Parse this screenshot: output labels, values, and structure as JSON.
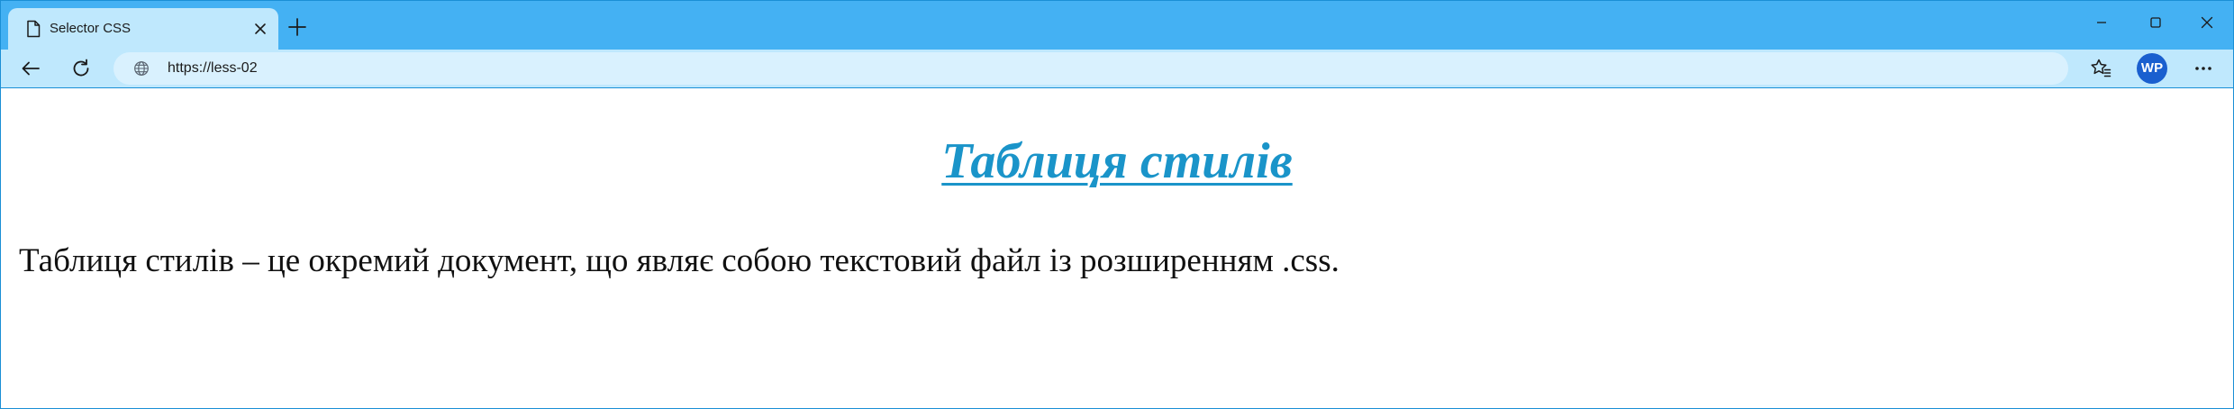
{
  "browser": {
    "tab": {
      "title": "Selector CSS"
    },
    "address_bar": {
      "url": "https://less-02"
    },
    "profile": {
      "initials": "WP",
      "color": "#1a5fcf"
    },
    "colors": {
      "tabstrip": "#44b1f3",
      "toolbar": "#bfe8fd",
      "border": "#1a8fd6"
    },
    "icons": {
      "page": "page-icon",
      "close": "close-icon",
      "new_tab": "plus-icon",
      "minimize": "minimize-icon",
      "maximize": "maximize-icon",
      "window_close": "close-icon",
      "back": "back-arrow-icon",
      "refresh": "refresh-icon",
      "site_info": "globe-icon",
      "favorites": "favorites-star-icon",
      "more": "more-dots-icon"
    }
  },
  "page": {
    "heading": "Таблиця стилів",
    "heading_color": "#1a94c9",
    "paragraph": "Таблиця стилів – це окремий документ, що являє собою текстовий файл із розширенням .css."
  }
}
